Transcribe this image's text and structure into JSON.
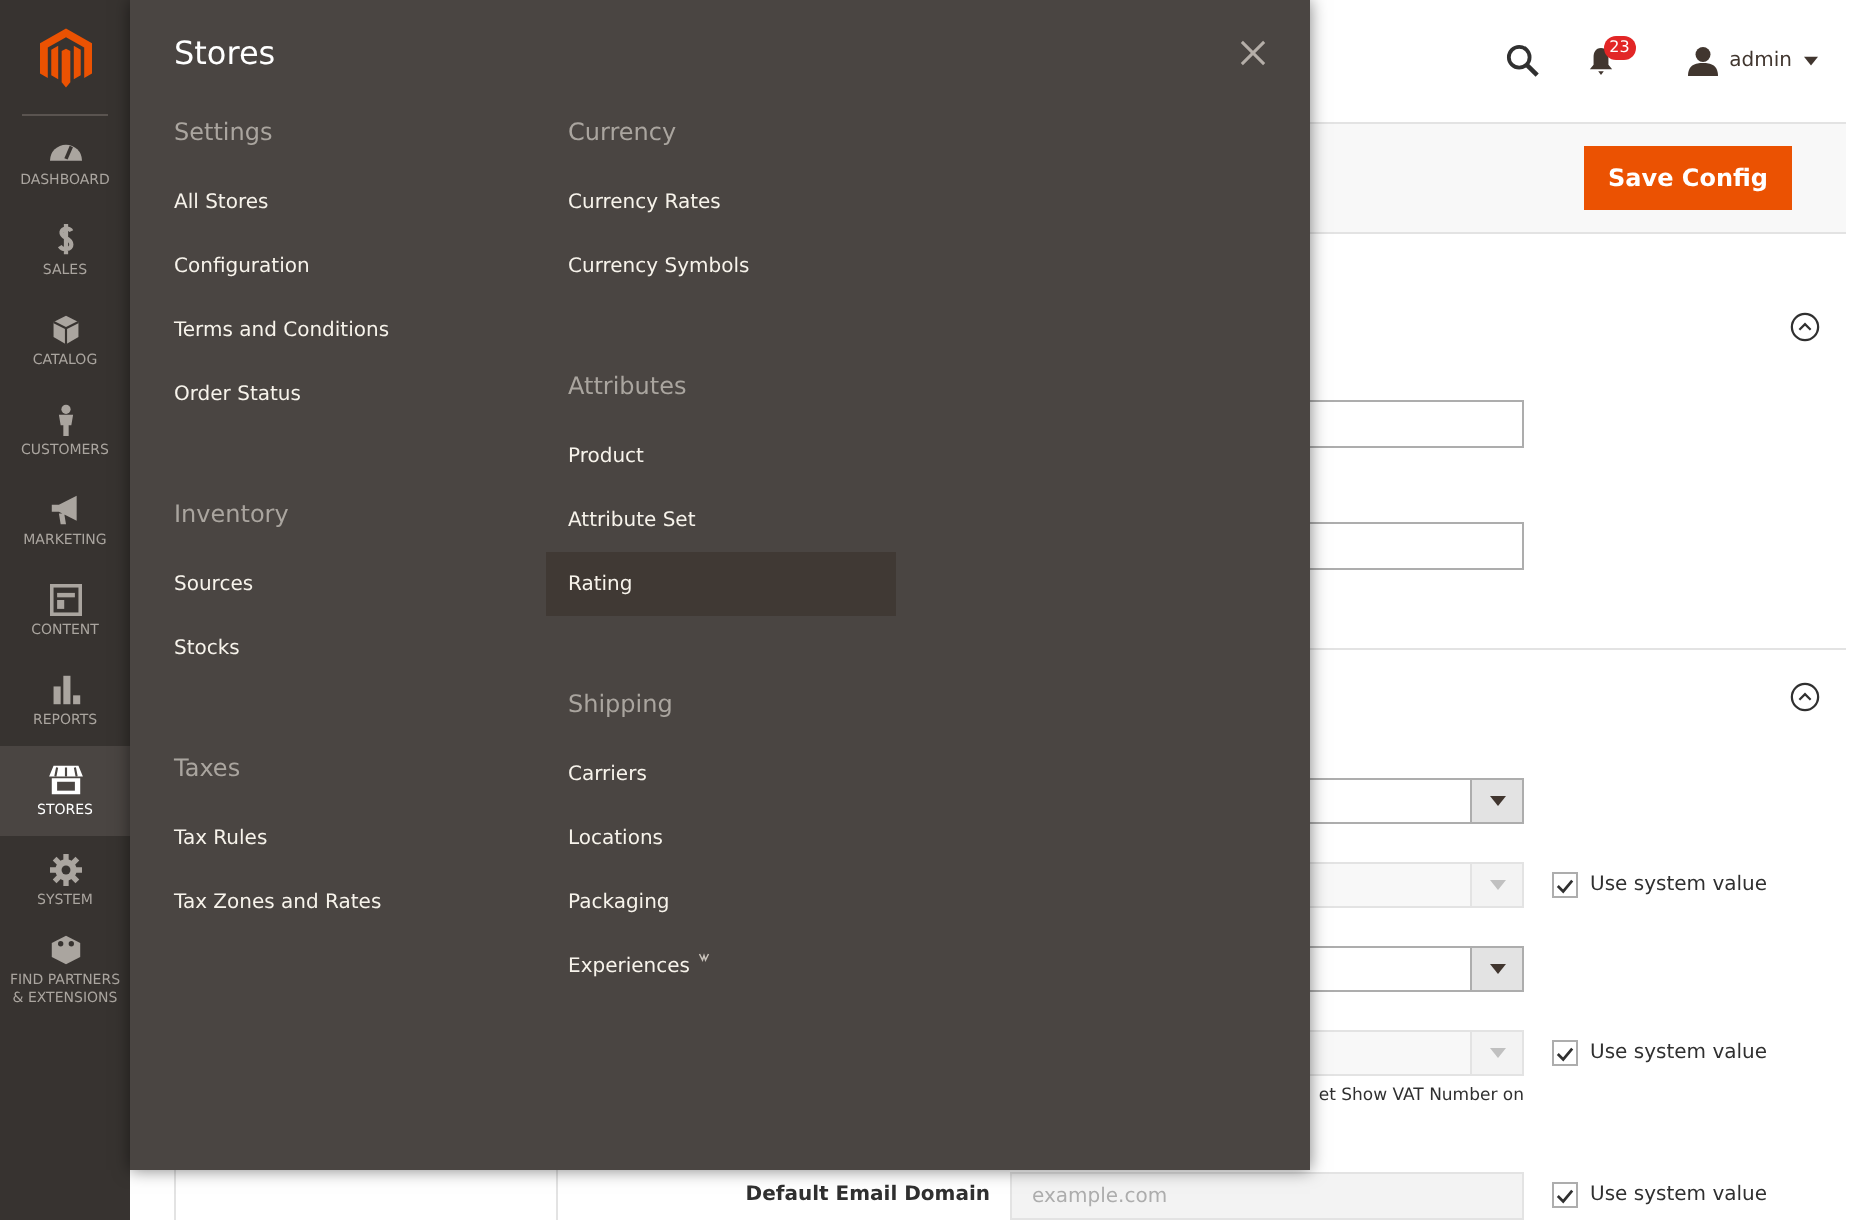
{
  "sidebar": {
    "items": [
      {
        "label": "DASHBOARD",
        "kind": "dashboard",
        "selected": false
      },
      {
        "label": "SALES",
        "kind": "sales",
        "selected": false
      },
      {
        "label": "CATALOG",
        "kind": "catalog",
        "selected": false
      },
      {
        "label": "CUSTOMERS",
        "kind": "customers",
        "selected": false
      },
      {
        "label": "MARKETING",
        "kind": "marketing",
        "selected": false
      },
      {
        "label": "CONTENT",
        "kind": "content",
        "selected": false
      },
      {
        "label": "REPORTS",
        "kind": "reports",
        "selected": false
      },
      {
        "label": "STORES",
        "kind": "stores",
        "selected": true
      },
      {
        "label": "SYSTEM",
        "kind": "system",
        "selected": false
      },
      {
        "label": "FIND PARTNERS & EXTENSIONS",
        "kind": "partners",
        "selected": false
      }
    ]
  },
  "header": {
    "notifications": "23",
    "user": "admin"
  },
  "actions": {
    "save_button": "Save Config"
  },
  "sections": [
    {
      "expanded": true,
      "fields": [
        {
          "kind": "text",
          "disabled": false
        },
        {
          "kind": "text",
          "disabled": false
        }
      ]
    },
    {
      "expanded": true,
      "fields": [
        {
          "kind": "select",
          "disabled": false
        },
        {
          "kind": "select",
          "disabled": true,
          "use_system_value": {
            "label": "Use system value",
            "checked": true
          }
        },
        {
          "kind": "select",
          "disabled": false
        },
        {
          "kind": "select",
          "disabled": true,
          "use_system_value": {
            "label": "Use system value",
            "checked": true
          },
          "note": "et Show VAT Number on"
        },
        {
          "kind": "text",
          "disabled": true,
          "label": "Default Email Domain",
          "placeholder": "example.com",
          "use_system_value": {
            "label": "Use system value",
            "checked": true
          }
        }
      ]
    }
  ],
  "menu": {
    "title": "Stores",
    "columns": [
      [
        {
          "title": "Settings",
          "items": [
            {
              "label": "All Stores",
              "selected": false
            },
            {
              "label": "Configuration",
              "selected": false
            },
            {
              "label": "Terms and Conditions",
              "selected": false
            },
            {
              "label": "Order Status",
              "selected": false
            }
          ]
        },
        {
          "title": "Inventory",
          "items": [
            {
              "label": "Sources",
              "selected": false
            },
            {
              "label": "Stocks",
              "selected": false
            }
          ]
        },
        {
          "title": "Taxes",
          "items": [
            {
              "label": "Tax Rules",
              "selected": false
            },
            {
              "label": "Tax Zones and Rates",
              "selected": false
            }
          ]
        }
      ],
      [
        {
          "title": "Currency",
          "items": [
            {
              "label": "Currency Rates",
              "selected": false
            },
            {
              "label": "Currency Symbols",
              "selected": false
            }
          ]
        },
        {
          "title": "Attributes",
          "items": [
            {
              "label": "Product",
              "selected": false
            },
            {
              "label": "Attribute Set",
              "selected": false
            },
            {
              "label": "Rating",
              "selected": true
            }
          ]
        },
        {
          "title": "Shipping",
          "items": [
            {
              "label": "Carriers",
              "selected": false
            },
            {
              "label": "Locations",
              "selected": false
            },
            {
              "label": "Packaging",
              "selected": false
            },
            {
              "label": "Experiences",
              "selected": false,
              "external": true
            }
          ]
        }
      ]
    ]
  }
}
